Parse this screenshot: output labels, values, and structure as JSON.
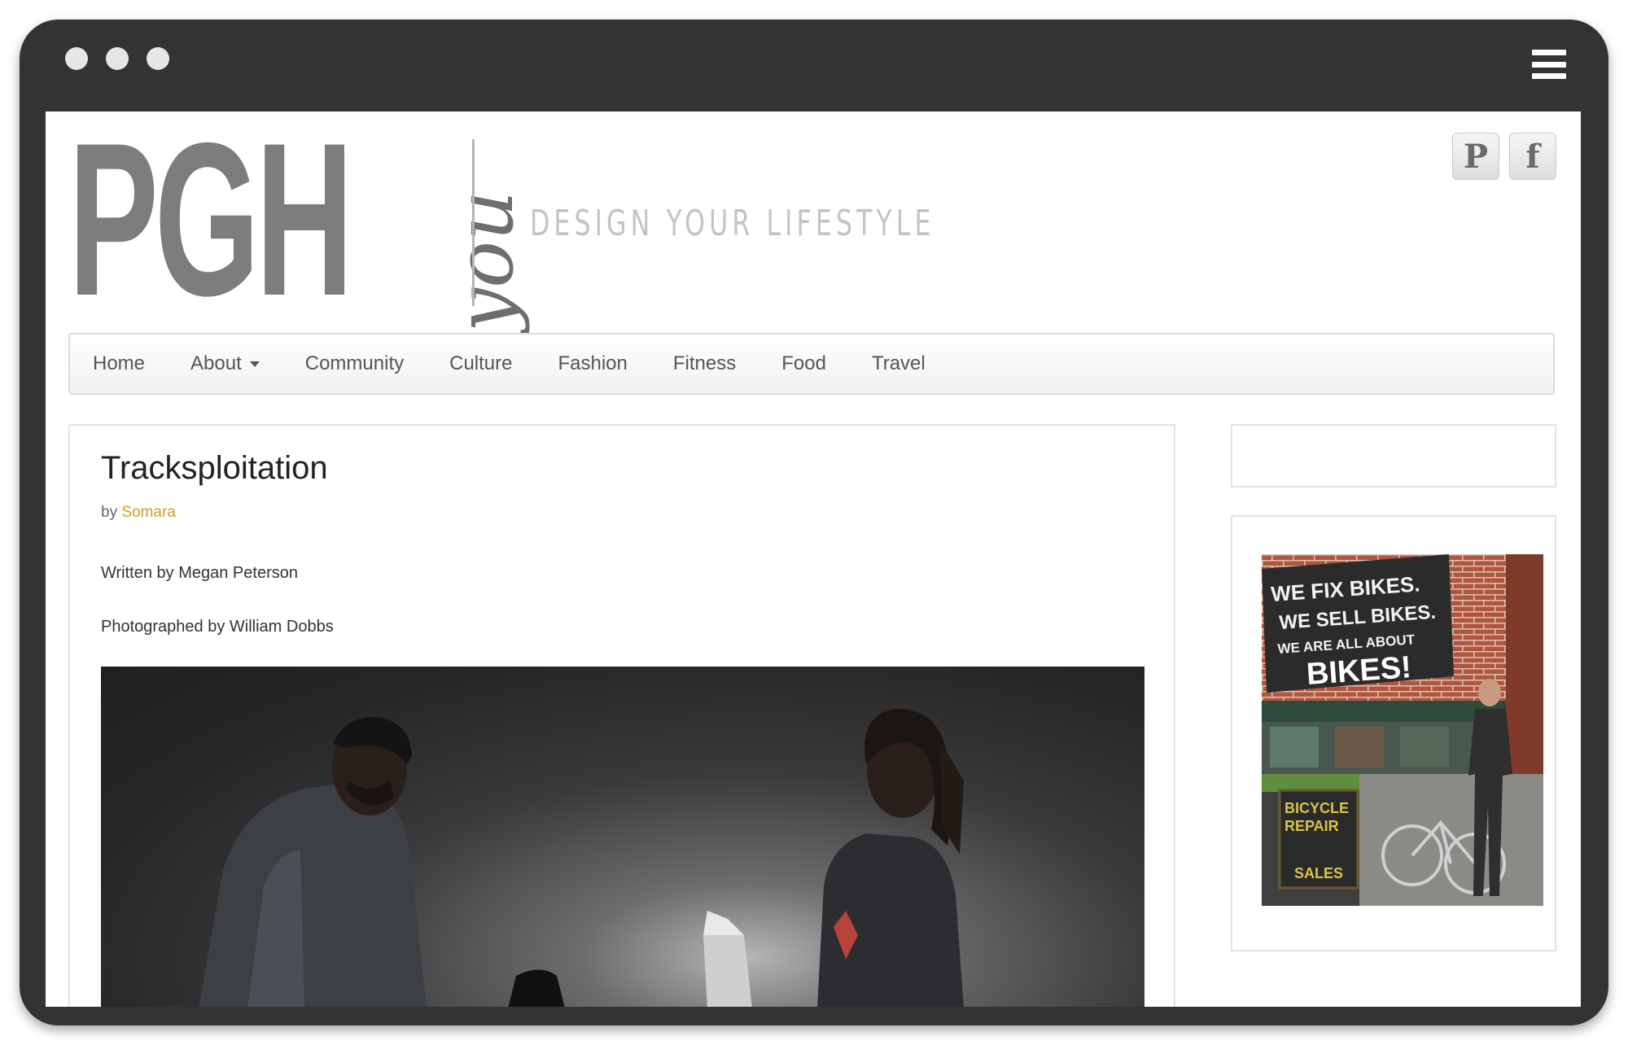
{
  "site": {
    "logo_text": "PGH",
    "logo_script": "you",
    "tagline": "DESIGN YOUR LIFESTYLE"
  },
  "social": [
    {
      "icon": "pinterest-icon",
      "glyph": "P"
    },
    {
      "icon": "facebook-icon",
      "glyph": "f"
    }
  ],
  "nav": {
    "items": [
      {
        "label": "Home"
      },
      {
        "label": "About",
        "has_dropdown": true
      },
      {
        "label": "Community"
      },
      {
        "label": "Culture"
      },
      {
        "label": "Fashion"
      },
      {
        "label": "Fitness"
      },
      {
        "label": "Food"
      },
      {
        "label": "Travel"
      }
    ]
  },
  "post": {
    "title": "Tracksploitation",
    "by_prefix": "by",
    "author": "Somara",
    "written_by": "Written  by Megan Peterson",
    "photographed_by": "Photographed by William Dobbs"
  },
  "ad": {
    "line1": "WE FIX BIKES.",
    "line2": "WE SELL BIKES.",
    "line3": "WE ARE ALL ABOUT",
    "line4": "BIKES!",
    "sign1": "BICYCLE",
    "sign2": "REPAIR",
    "sign3": "SALES"
  },
  "colors": {
    "frame": "#333333",
    "accent_author": "#c9a227",
    "logo_gray": "#7d7d7d"
  }
}
